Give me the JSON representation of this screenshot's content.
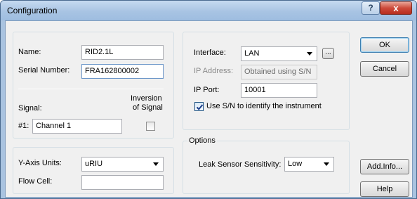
{
  "window": {
    "title": "Configuration",
    "help_button": "?",
    "close_button": "x"
  },
  "instrument": {
    "name_label": "Name:",
    "name_value": "RID2.1L",
    "serial_label": "Serial Number:",
    "serial_value": "FRA162800002"
  },
  "signal": {
    "signal_label": "Signal:",
    "inversion_label_line1": "Inversion",
    "inversion_label_line2": "of Signal",
    "channel_label": "#1:",
    "channel_value": "Channel 1",
    "inversion_checked": false
  },
  "axis": {
    "units_label": "Y-Axis Units:",
    "units_value": "uRIU",
    "flow_cell_label": "Flow Cell:",
    "flow_cell_value": ""
  },
  "interface": {
    "interface_label": "Interface:",
    "interface_value": "LAN",
    "browse_label": "...",
    "ip_label": "IP Address:",
    "ip_value": "Obtained using S/N",
    "port_label": "IP Port:",
    "port_value": "10001",
    "use_sn_label": "Use S/N to identify the instrument",
    "use_sn_checked": true
  },
  "options": {
    "legend": "Options",
    "leak_label": "Leak Sensor Sensitivity:",
    "leak_value": "Low"
  },
  "buttons": {
    "ok": "OK",
    "cancel": "Cancel",
    "add_info": "Add.Info...",
    "help": "Help"
  }
}
